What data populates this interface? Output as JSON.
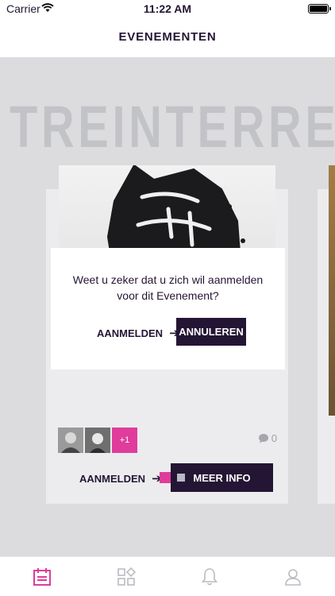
{
  "status_bar": {
    "carrier": "Carrier",
    "time": "11:22 AM"
  },
  "nav": {
    "title": "EVENEMENTEN"
  },
  "background_title": "TREINTERREAU",
  "event_card": {
    "attendees_more": "+1",
    "comment_count": "0",
    "register_label": "AANMELDEN",
    "more_info_label": "MEER INFO"
  },
  "pagination": {
    "active_index": 0,
    "total": 2
  },
  "dialog": {
    "message": "Weet u zeker dat u zich wil aanmelden voor dit Evenement?",
    "register_label": "AANMELDEN",
    "cancel_label": "ANNULEREN"
  },
  "tab_bar": {
    "tabs": [
      {
        "icon": "calendar-icon",
        "active": true
      },
      {
        "icon": "grid-icon",
        "active": false
      },
      {
        "icon": "bell-icon",
        "active": false
      },
      {
        "icon": "user-icon",
        "active": false
      }
    ]
  },
  "colors": {
    "accent": "#e03c9b",
    "primary": "#241534",
    "inactive": "#b9bbc2"
  }
}
